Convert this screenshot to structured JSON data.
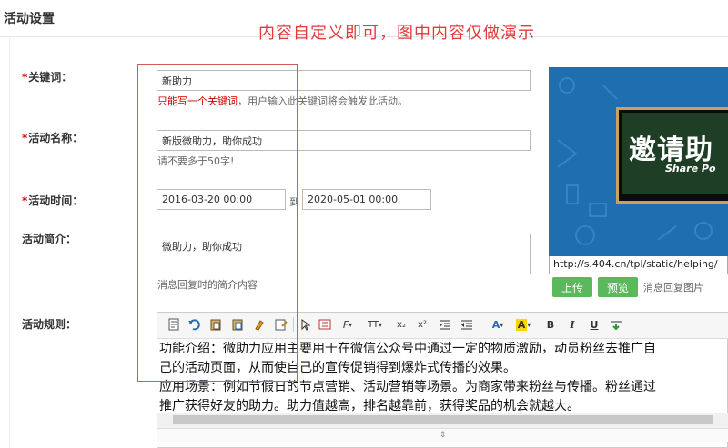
{
  "section_title": "活动设置",
  "annotation": "内容自定义即可，图中内容仅做演示",
  "form": {
    "keyword": {
      "label": "关键词：",
      "value": "新助力",
      "hint_red": "只能写一个关键词",
      "hint_rest": "，用户输入此关键词将会触发此活动。"
    },
    "name": {
      "label": "活动名称：",
      "value": "新版微助力，助你成功",
      "hint": "请不要多于50字!"
    },
    "time": {
      "label": "活动时间：",
      "start": "2016-03-20 00:00",
      "to": "到",
      "end": "2020-05-01 00:00"
    },
    "intro": {
      "label": "活动简介：",
      "value": "微助力，助你成功",
      "hint": "消息回复时的简介内容"
    },
    "rules": {
      "label": "活动规则：",
      "lines": [
        "功能介绍：微助力应用主要用于在微信公众号中通过一定的物质激励，动员粉丝去推广自",
        "己的活动页面，从而使自己的宣传促销得到爆炸式传播的效果。",
        "应用场景：例如节假日的节点营销、活动营销等场景。为商家带来粉丝与传播。粉丝通过",
        "推广获得好友的助力。助力值越高，排名越靠前，获得奖品的机会就越大。"
      ]
    }
  },
  "image": {
    "title_text": "邀请助",
    "subtitle_text": "Share Po",
    "url": "http://s.404.cn/tpl/static/helping/",
    "upload_label": "上传",
    "preview_label": "预览",
    "caption": "消息回复图片"
  },
  "toolbar_icons": [
    "source-icon",
    "undo-icon",
    "paste-icon",
    "paste-text-icon",
    "clear-format-icon",
    "paste-word-icon",
    "select-icon",
    "fullscreen-icon",
    "font-family-icon",
    "font-size-icon",
    "subscript-icon",
    "superscript-icon",
    "indent-icon",
    "outdent-icon",
    "font-color-icon",
    "highlight-icon",
    "bold-icon",
    "italic-icon",
    "underline-icon",
    "insert-icon"
  ],
  "toolbar_glyphs": {
    "font_family": "F",
    "font_size": "TT",
    "subscript": "x₂",
    "superscript": "x²",
    "font_color": "A",
    "highlight": "A",
    "bold": "B",
    "italic": "I",
    "underline": "U"
  },
  "colors": {
    "required": "#cc0000",
    "annotation": "#e03b3b",
    "button_green": "#5cb85c",
    "preview_bg": "#1f6fb0"
  }
}
